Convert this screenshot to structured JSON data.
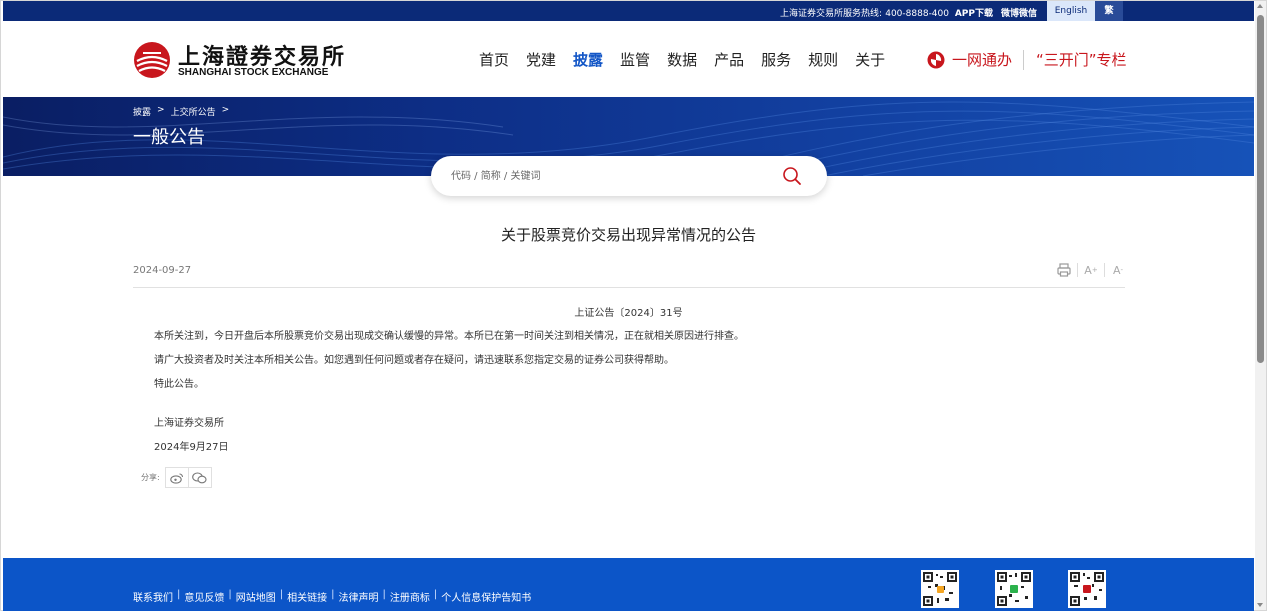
{
  "topbar": {
    "hotline_label": "上海证券交易所服务热线:",
    "hotline_number": "400-8888-400",
    "app_download": "APP下载",
    "weibo_weixin": "微博微信",
    "lang_english": "English",
    "lang_traditional": "繁"
  },
  "header": {
    "logo_cn": "上海證券交易所",
    "logo_en": "SHANGHAI STOCK EXCHANGE",
    "nav": [
      "首页",
      "党建",
      "披露",
      "监管",
      "数据",
      "产品",
      "服务",
      "规则",
      "关于"
    ],
    "active_nav": "披露",
    "yiwang": "一网通办",
    "sankai": "“三开门”专栏"
  },
  "banner": {
    "breadcrumb": [
      "披露",
      "上交所公告"
    ],
    "title": "一般公告"
  },
  "search": {
    "placeholder": "代码 / 简称 / 关键词"
  },
  "article": {
    "title": "关于股票竞价交易出现异常情况的公告",
    "date": "2024-09-27",
    "doc_no": "上证公告〔2024〕31号",
    "paragraphs": [
      "本所关注到，今日开盘后本所股票竞价交易出现成交确认缓慢的异常。本所已在第一时间关注到相关情况，正在就相关原因进行排查。",
      "请广大投资者及时关注本所相关公告。如您遇到任何问题或者存在疑问，请迅速联系您指定交易的证券公司获得帮助。",
      "特此公告。"
    ],
    "signature": "上海证券交易所",
    "sign_date": "2024年9月27日",
    "share_label": "分享:"
  },
  "footer": {
    "links": [
      "联系我们",
      "意见反馈",
      "网站地图",
      "相关链接",
      "法律声明",
      "注册商标",
      "个人信息保护告知书"
    ]
  },
  "colors": {
    "topbar": "#0b2a78",
    "nav_active": "#1457c7",
    "accent_red": "#c8161d",
    "footer": "#0c55c8"
  }
}
